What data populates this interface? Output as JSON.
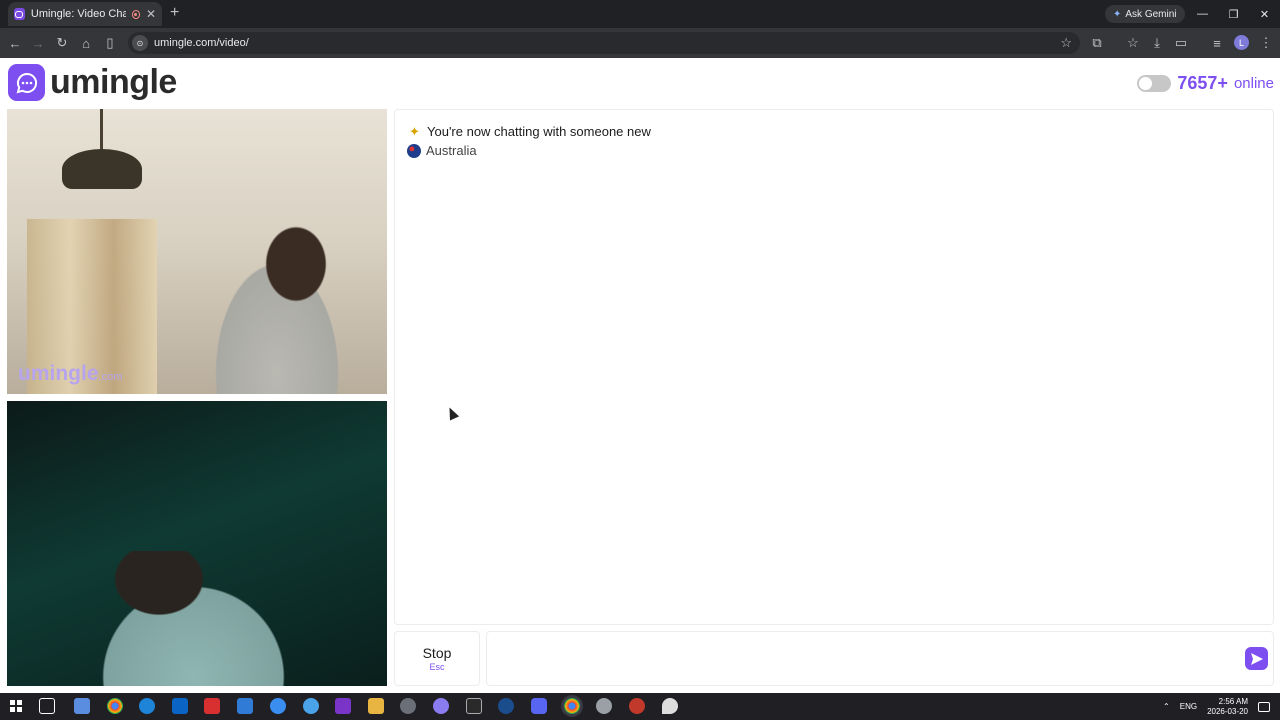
{
  "browser": {
    "tab_title": "Umingle: Video Chat with Strangers",
    "gemini_label": "Ask Gemini",
    "url": "umingle.com/video/",
    "profile_initial": "L"
  },
  "header": {
    "logo_text": "umingle",
    "online_count": "7657+",
    "online_label": "online"
  },
  "video": {
    "watermark_brand": "umingle",
    "watermark_tld": ".com"
  },
  "chat": {
    "system_message": "You're now chatting with someone new",
    "country": "Australia"
  },
  "controls": {
    "stop_label": "Stop",
    "stop_hint": "Esc",
    "message_placeholder": ""
  },
  "taskbar": {
    "language": "ENG",
    "time": "2:56 AM",
    "date": "2026-03-20",
    "apps": [
      "task-view",
      "photos",
      "chrome",
      "edge",
      "outlook",
      "dts",
      "store",
      "messenger",
      "browser",
      "media",
      "files",
      "settings-gear",
      "discord",
      "epic",
      "steam",
      "chat",
      "chrome-active",
      "settings",
      "recorder",
      "pen"
    ]
  },
  "colors": {
    "brand": "#7d4ef0",
    "chrome_dark": "#202124",
    "toolbar": "#35363a"
  }
}
